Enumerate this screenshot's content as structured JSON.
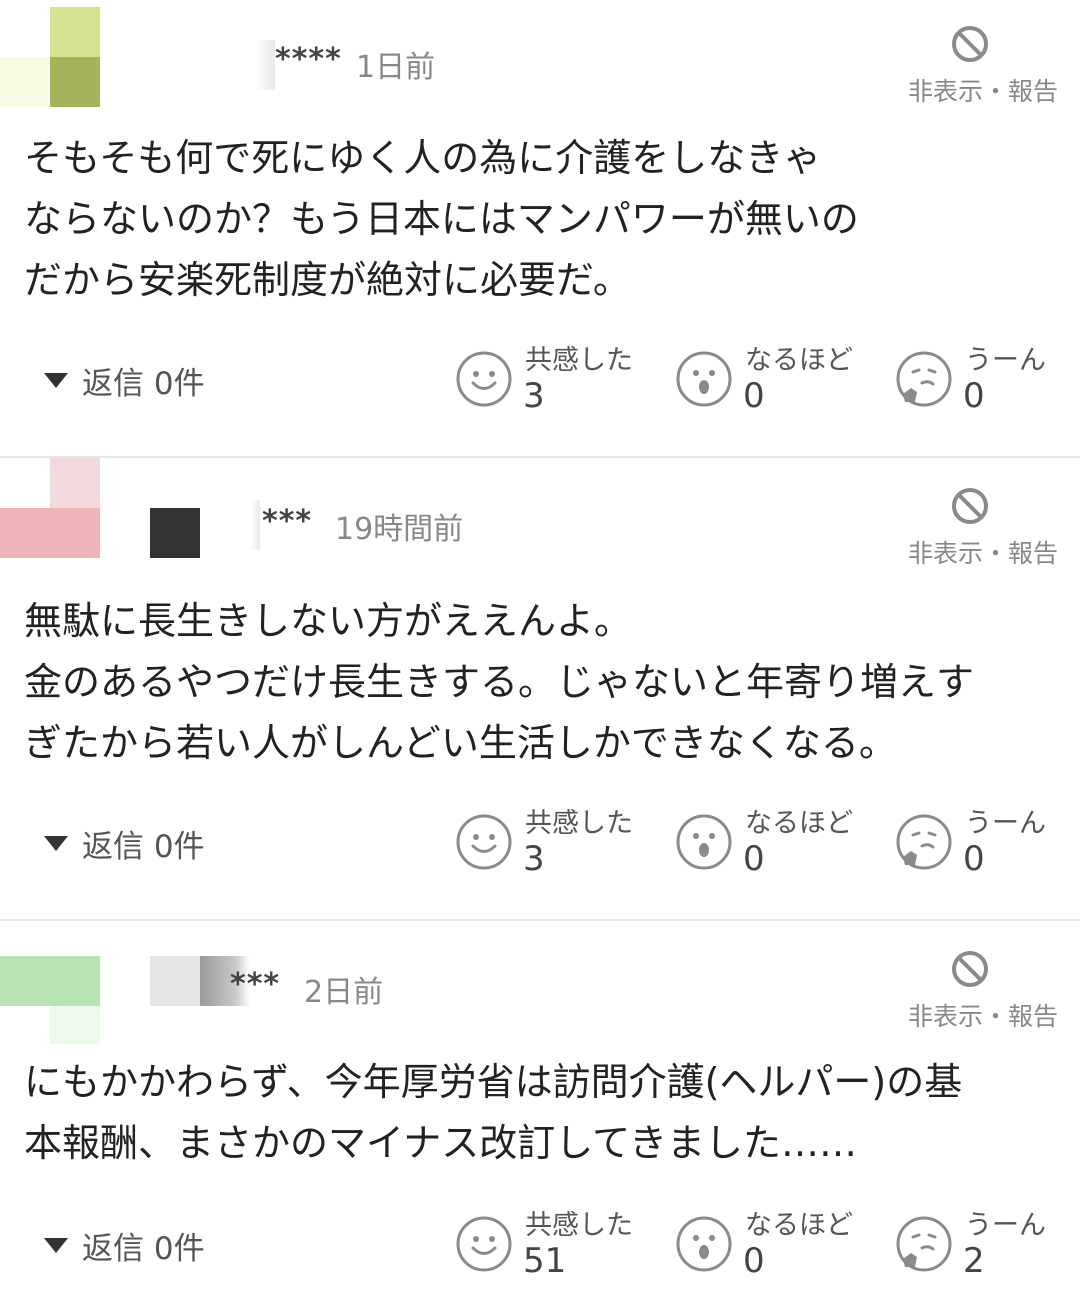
{
  "hide_report_label": "非表示・報告",
  "reaction_labels": {
    "empathy": "共感した",
    "naruhodo": "なるほど",
    "uun": "うーん"
  },
  "comments": [
    {
      "username": "****",
      "time": "1日前",
      "body": "そもそも何で死にゆく人の為に介護をしなきゃ\nならないのか？もう日本にはマンパワーが無いの\nだから安楽死制度が絶対に必要だ。",
      "reply_label": "返信 0件",
      "reactions": {
        "empathy": "3",
        "naruhodo": "0",
        "uun": "0"
      }
    },
    {
      "username": "***",
      "time": "19時間前",
      "body": "無駄に長生きしない方がええんよ。\n金のあるやつだけ長生きする。じゃないと年寄り増えす\nぎたから若い人がしんどい生活しかできなくなる。",
      "reply_label": "返信 0件",
      "reactions": {
        "empathy": "3",
        "naruhodo": "0",
        "uun": "0"
      }
    },
    {
      "username": "***",
      "time": "2日前",
      "body": "にもかかわらず、今年厚労省は訪問介護(ヘルパー)の基\n本報酬、まさかのマイナス改訂してきました……",
      "reply_label": "返信 0件",
      "reactions": {
        "empathy": "51",
        "naruhodo": "0",
        "uun": "2"
      }
    }
  ],
  "colors": {
    "avatar1": [
      "#d6e28f",
      "#a5b45a",
      "#f6fbe3"
    ],
    "avatar2": [
      "#f1dadc",
      "#eeb4b9"
    ],
    "avatar3": [
      "#b9e2b5",
      "#eefaec"
    ],
    "icon": "#8a8a8a"
  }
}
